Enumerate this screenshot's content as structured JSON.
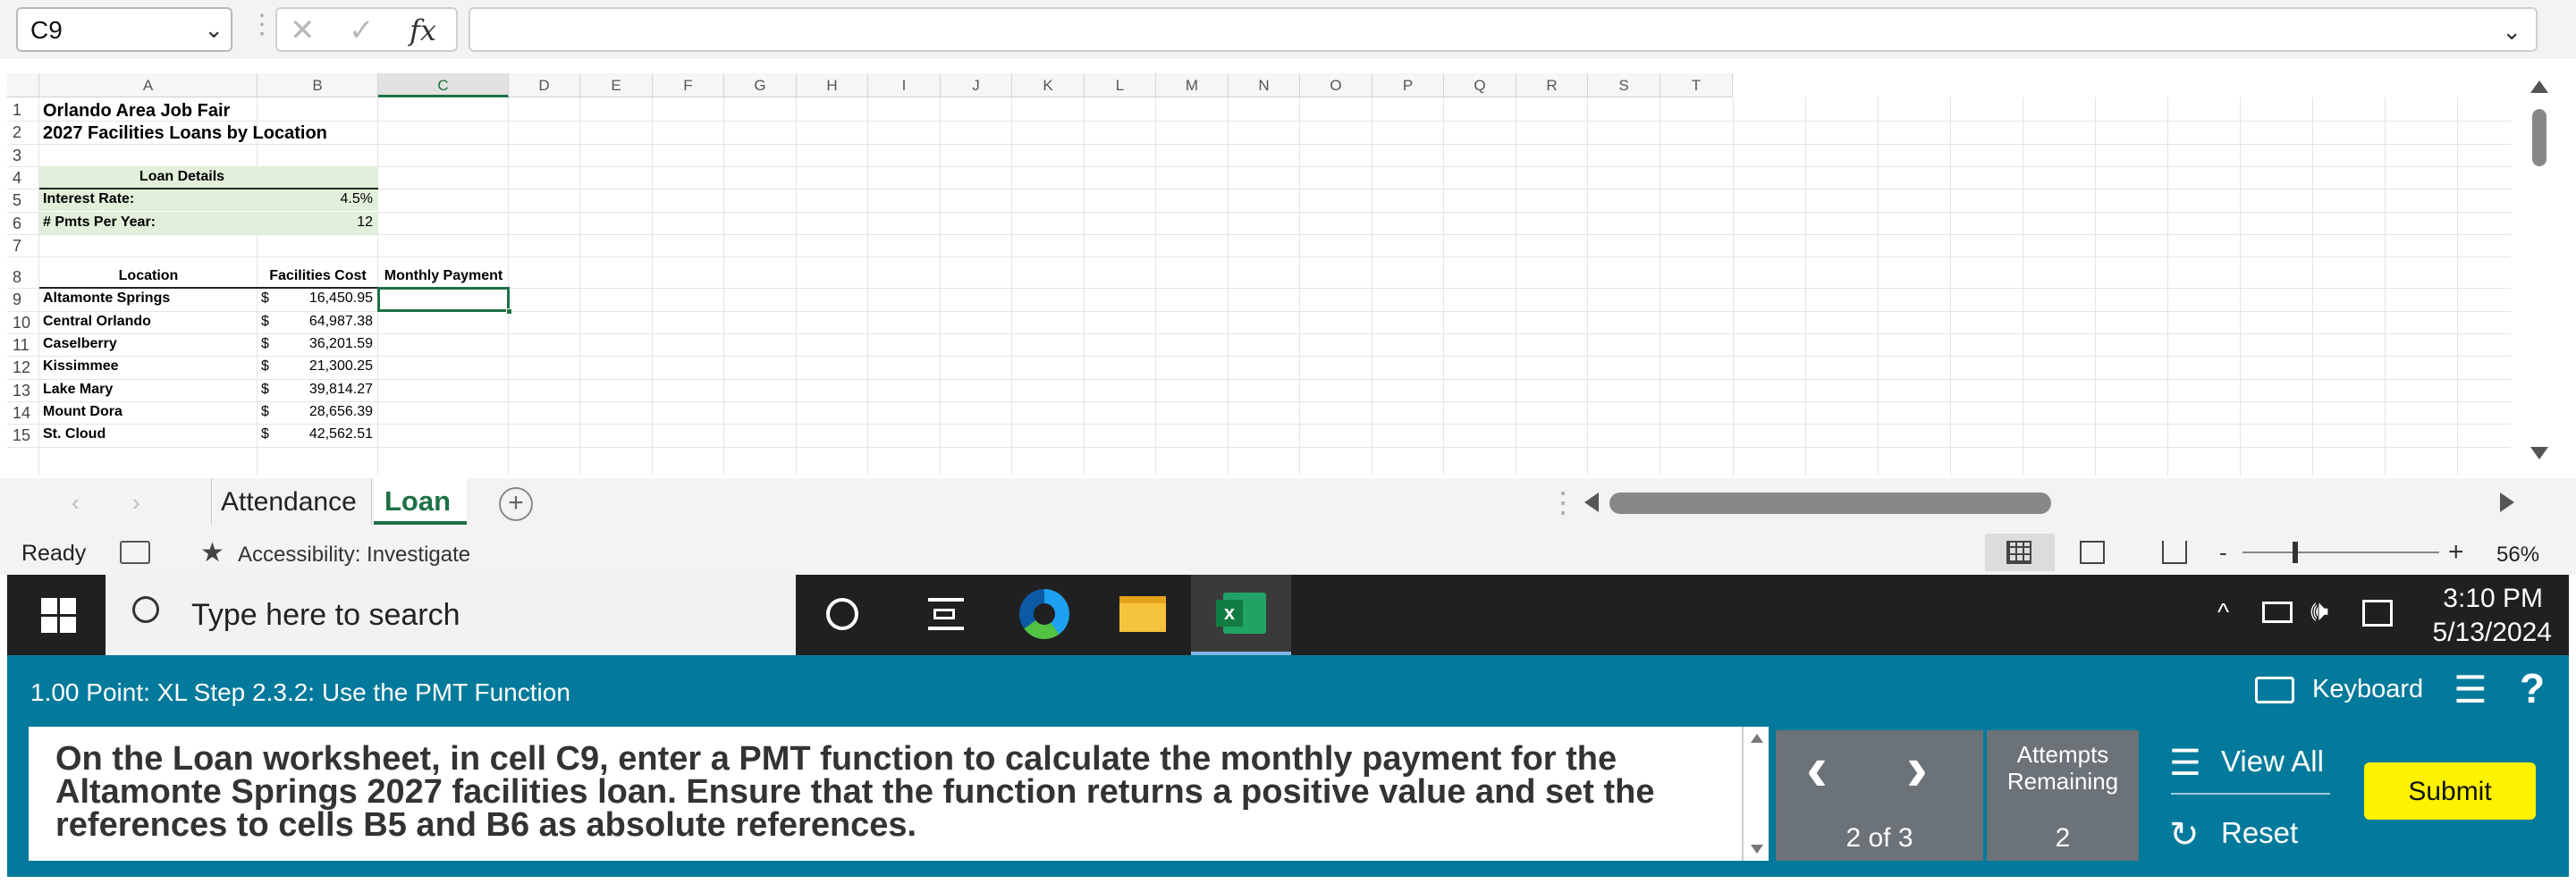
{
  "formula_bar": {
    "name_box": "C9",
    "formula": ""
  },
  "columns": [
    "A",
    "B",
    "C",
    "D",
    "E",
    "F",
    "G",
    "H",
    "I",
    "J",
    "K",
    "L",
    "M",
    "N",
    "O",
    "P",
    "Q",
    "R",
    "S",
    "T"
  ],
  "selected_column": "C",
  "row_numbers": [
    "1",
    "2",
    "3",
    "4",
    "5",
    "6",
    "7",
    "8",
    "9",
    "10",
    "11",
    "12",
    "13",
    "14",
    "15"
  ],
  "cells": {
    "a1": "Orlando Area Job Fair",
    "a2": "2027 Facilities Loans by Location",
    "loan_details_header": "Loan Details",
    "a5": "Interest Rate:",
    "b5": "4.5%",
    "a6": "# Pmts Per Year:",
    "b6": "12",
    "a8": "Location",
    "b8": "Facilities Cost",
    "c8": "Monthly Payment"
  },
  "locations": [
    {
      "name": "Altamonte Springs",
      "cur": "$",
      "cost": "16,450.95"
    },
    {
      "name": "Central Orlando",
      "cur": "$",
      "cost": "64,987.38"
    },
    {
      "name": "Caselberry",
      "cur": "$",
      "cost": "36,201.59"
    },
    {
      "name": "Kissimmee",
      "cur": "$",
      "cost": "21,300.25"
    },
    {
      "name": "Lake Mary",
      "cur": "$",
      "cost": "39,814.27"
    },
    {
      "name": "Mount Dora",
      "cur": "$",
      "cost": "28,656.39"
    },
    {
      "name": "St. Cloud",
      "cur": "$",
      "cost": "42,562.51"
    }
  ],
  "sheet_tabs": [
    "Attendance",
    "Loan"
  ],
  "active_tab": "Loan",
  "status": {
    "ready": "Ready",
    "accessibility": "Accessibility: Investigate",
    "zoom": "56%"
  },
  "taskbar": {
    "search_placeholder": "Type here to search",
    "time": "3:10 PM",
    "date": "5/13/2024"
  },
  "task": {
    "header": "1.00 Point: XL Step 2.3.2: Use the PMT Function",
    "instruction": "On the Loan worksheet, in cell C9, enter a PMT function to calculate the monthly payment for the Altamonte Springs 2027 facilities loan. Ensure that the function returns a positive value and set the references to cells B5 and B6 as absolute references.",
    "keyboard_label": "Keyboard",
    "progress": "2 of 3",
    "attempts_label": "Attempts Remaining",
    "attempts_value": "2",
    "view_all": "View All",
    "reset": "Reset",
    "submit": "Submit"
  },
  "colors": {
    "excel_green": "#1e7145",
    "panel_teal": "#037a9b",
    "submit_yellow": "#fff200",
    "loan_fill": "#e2efda"
  }
}
